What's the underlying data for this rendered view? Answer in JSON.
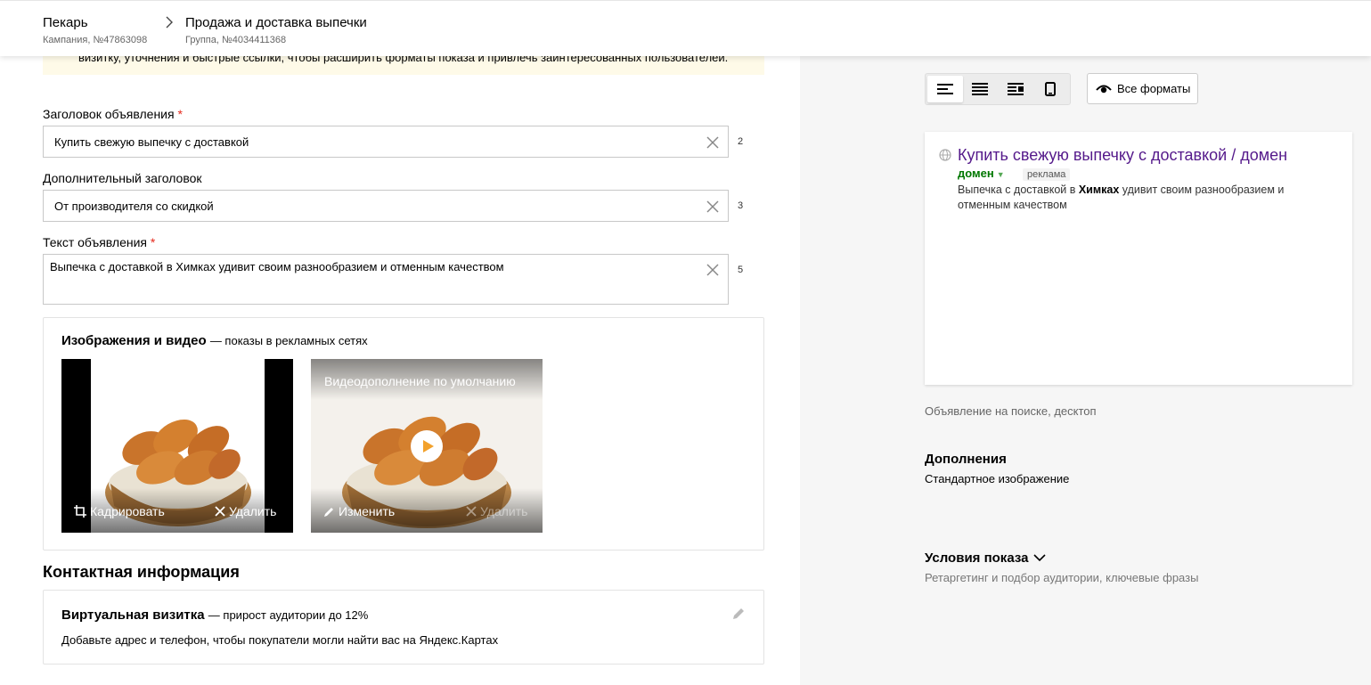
{
  "header": {
    "campaign_title": "Пекарь",
    "campaign_id": "Кампания, №47863098",
    "group_title": "Продажа и доставка выпечки",
    "group_id": "Группа, №4034411368"
  },
  "notice": {
    "text": "визитку, уточнения и быстрые ссылки, чтобы расширить форматы показа и привлечь заинтересованных пользователей."
  },
  "form": {
    "title_label": "Заголовок объявления",
    "title_value": "Купить свежую выпечку с доставкой",
    "title_counter": "2",
    "subtitle_label": "Дополнительный заголовок",
    "subtitle_value": "От производителя со скидкой",
    "subtitle_counter": "3",
    "text_label": "Текст объявления",
    "text_value": "Выпечка с доставкой в Химках удивит своим разнообразием и отменным качеством",
    "text_counter": "5",
    "required_mark": "*"
  },
  "media": {
    "title": "Изображения и видео",
    "subtitle": "— показы в рекламных сетях",
    "image_crop": "Кадрировать",
    "image_delete": "Удалить",
    "video_title": "Видеодополнение по умолчанию",
    "video_edit": "Изменить",
    "video_delete": "Удалить"
  },
  "contacts": {
    "heading": "Контактная информация",
    "card_title": "Виртуальная визитка",
    "card_subtitle": "— прирост аудитории до 12%",
    "card_text": "Добавьте адрес и телефон, чтобы покупатели могли найти вас на Яндекс.Картах"
  },
  "preview": {
    "all_formats": "Все форматы",
    "ad_title": "Купить свежую выпечку с доставкой / домен",
    "ad_domain": "домен",
    "ad_label": "реклама",
    "ad_text_before": "Выпечка с доставкой в ",
    "ad_text_bold": "Химках",
    "ad_text_after": " удивит своим разнообразием и отменным качеством",
    "caption": "Объявление на поиске, десктоп"
  },
  "extras": {
    "heading": "Дополнения",
    "value": "Стандартное изображение"
  },
  "conditions": {
    "heading": "Условия показа",
    "subtitle": "Ретаргетинг и подбор аудитории, ключевые фразы"
  },
  "colors": {
    "accent_link": "#551a8b",
    "domain_green": "#007700",
    "required_red": "#e5291c",
    "notice_bg": "#fefae8"
  }
}
